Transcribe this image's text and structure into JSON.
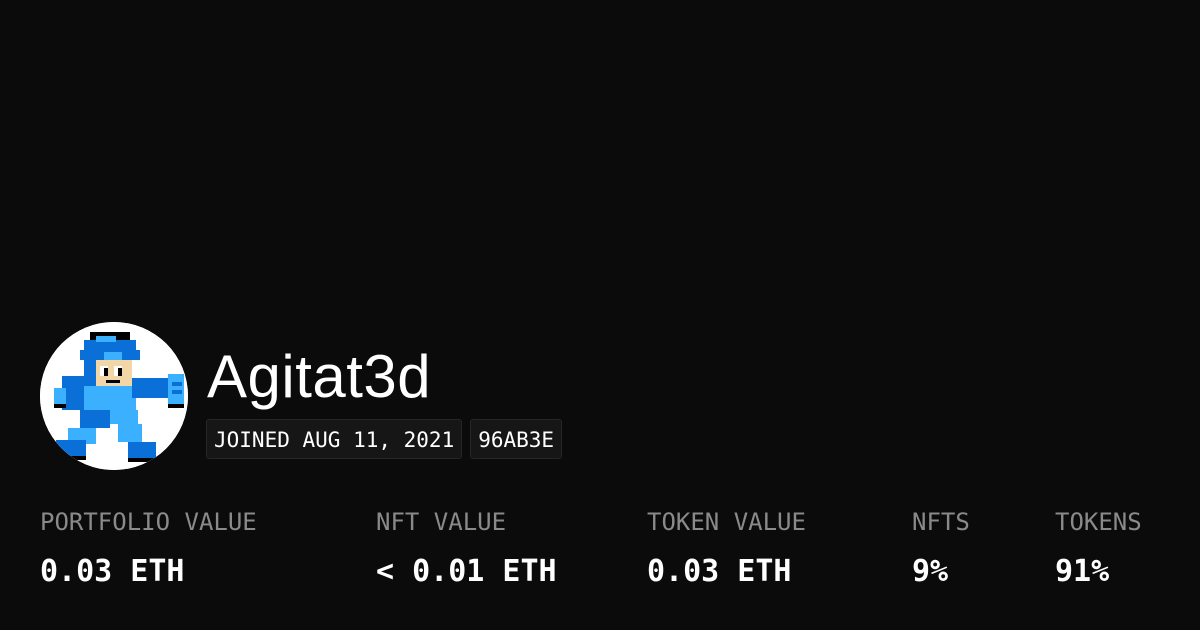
{
  "profile": {
    "username": "Agitat3d",
    "joined": "JOINED AUG 11, 2021",
    "address_short": "96AB3E",
    "avatar_icon": "pixel-megaman-avatar"
  },
  "stats": [
    {
      "label": "PORTFOLIO VALUE",
      "value": "0.03 ETH"
    },
    {
      "label": "NFT VALUE",
      "value": "< 0.01 ETH"
    },
    {
      "label": "TOKEN VALUE",
      "value": "0.03 ETH"
    },
    {
      "label": "NFTS",
      "value": "9%"
    },
    {
      "label": "TOKENS",
      "value": "91%"
    }
  ],
  "colors": {
    "background": "#0b0b0b",
    "text": "#ffffff",
    "muted": "#8a8a8a",
    "badge_bg": "#161616"
  }
}
